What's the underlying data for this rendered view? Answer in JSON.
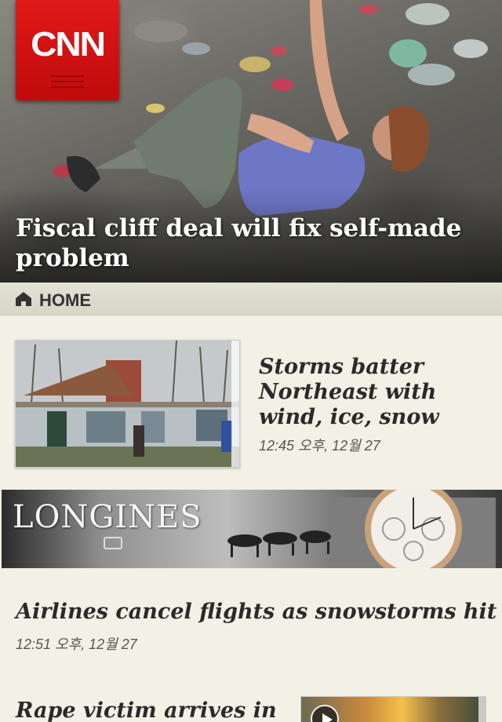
{
  "brand": {
    "logo_text": "CNN",
    "logo_color": "#d41111"
  },
  "hero": {
    "headline": "Fiscal cliff deal will fix self-made problem"
  },
  "section_bar": {
    "icon": "home-icon",
    "label": "HOME"
  },
  "stories": [
    {
      "title": "Storms batter Northeast with wind, ice, snow",
      "time": "12:45 오후, 12월 27"
    },
    {
      "title": "Airlines cancel flights as snowstorms hit",
      "time": "12:51 오후, 12월 27"
    },
    {
      "title": "Rape victim arrives in"
    }
  ],
  "advertisement": {
    "brand": "LONGINES"
  },
  "colors": {
    "background": "#f3f0e6",
    "section_bar": "#dedacd",
    "headline_text": "#2a2a2a"
  }
}
